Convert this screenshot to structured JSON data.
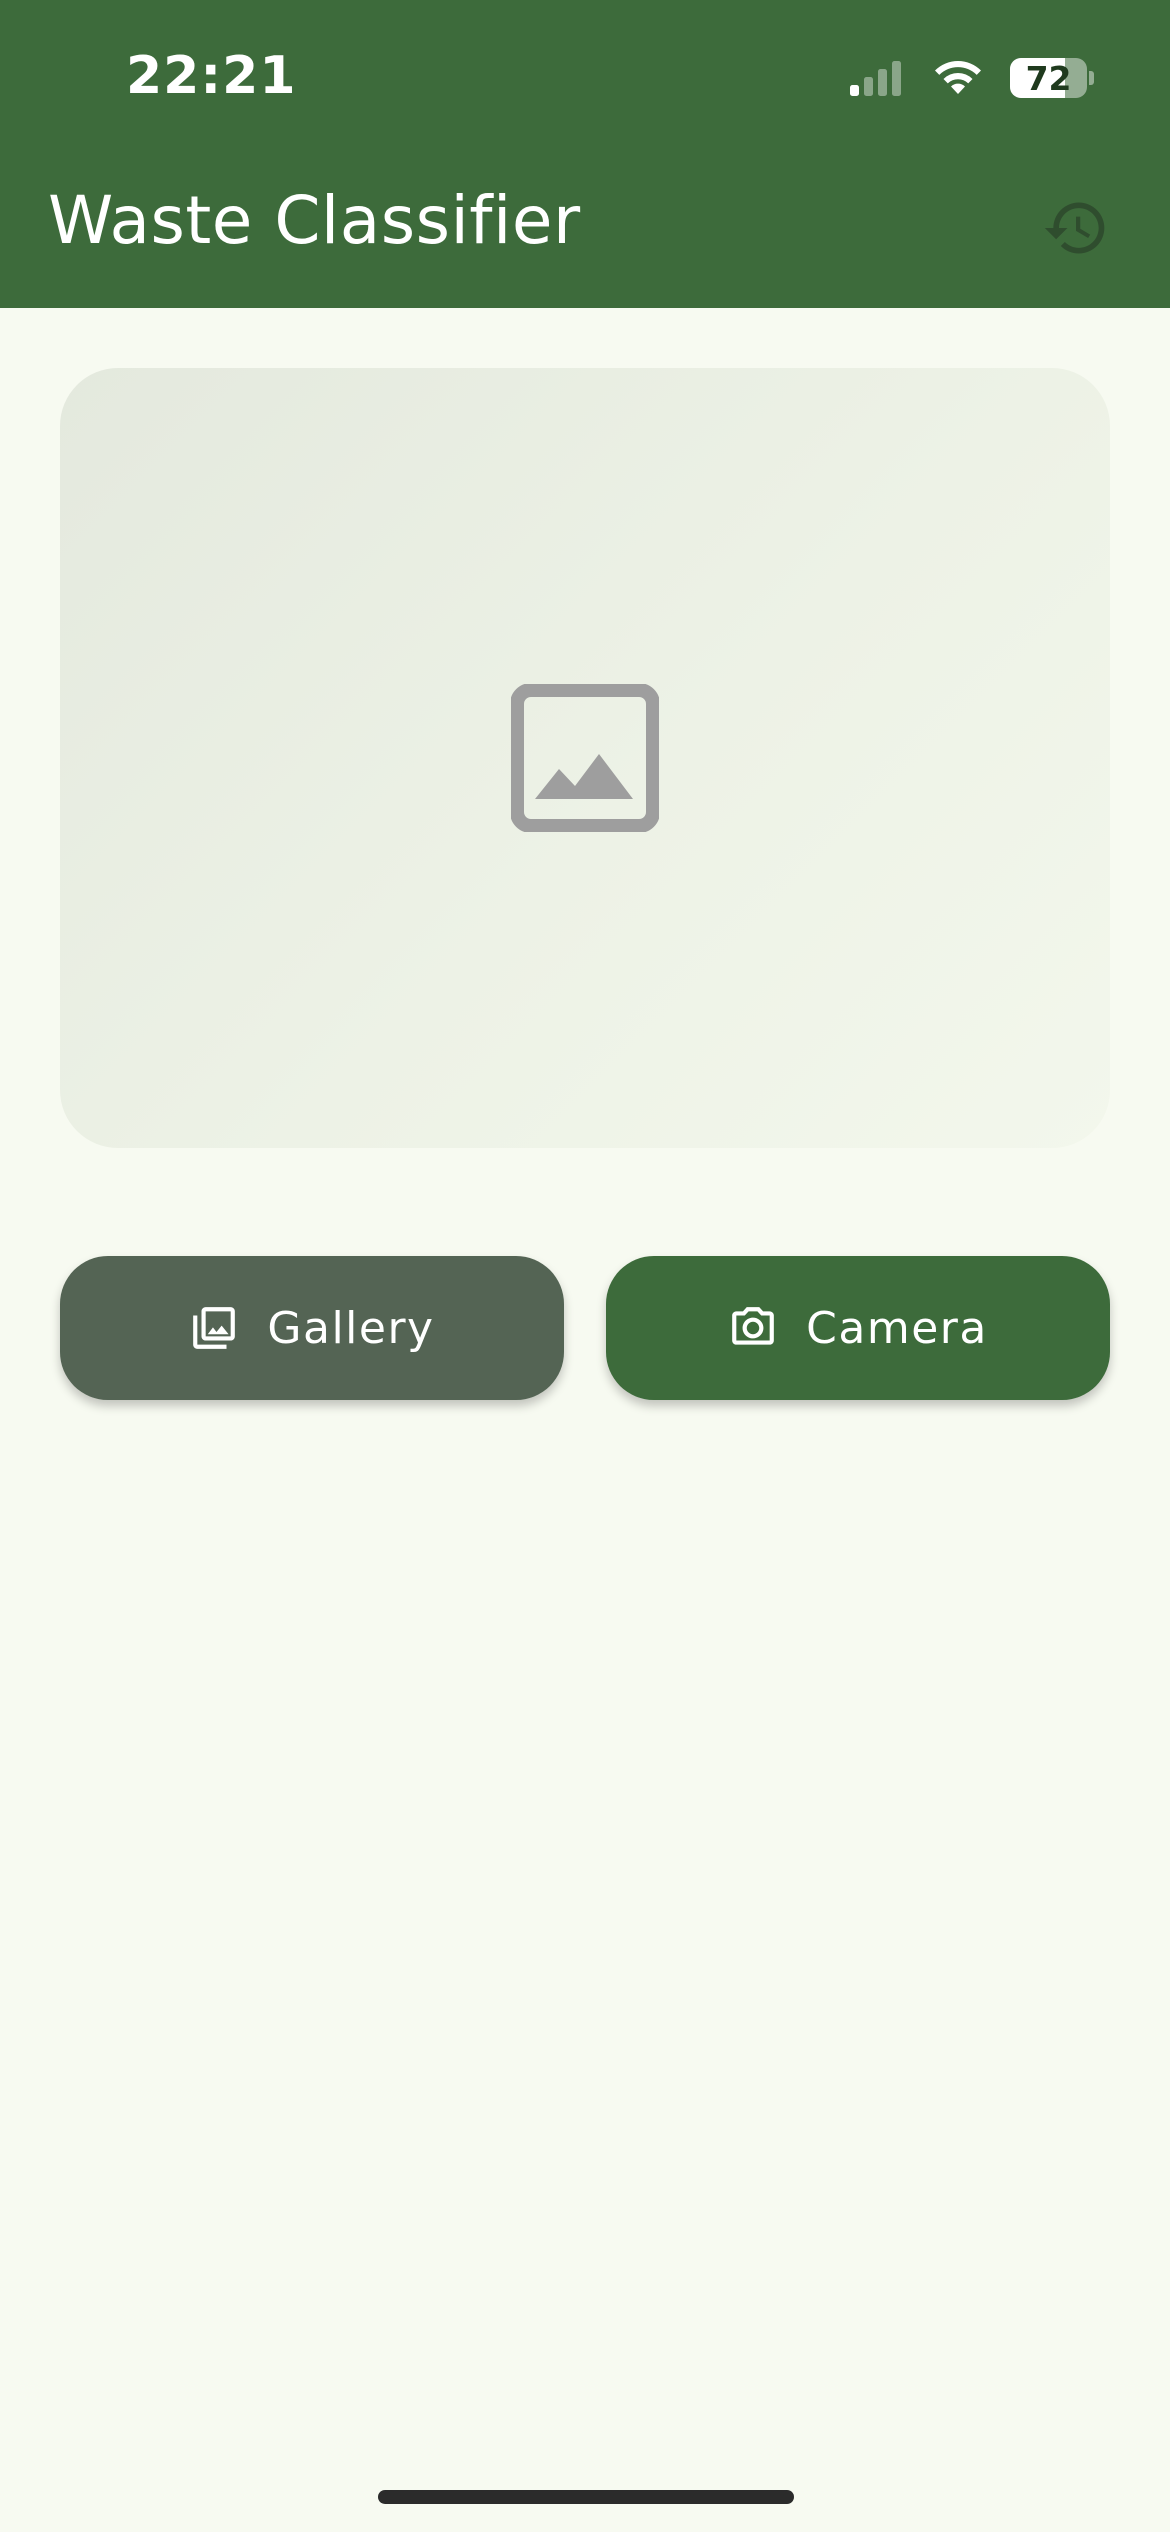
{
  "status_bar": {
    "time": "22:21",
    "battery_level": "72",
    "signal_icon": "cellular-signal-icon",
    "wifi_icon": "wifi-icon",
    "battery_icon": "battery-icon"
  },
  "app_bar": {
    "title": "Waste Classifier",
    "history_icon": "history-icon"
  },
  "preview": {
    "placeholder_icon": "image-placeholder-icon"
  },
  "actions": {
    "gallery_label": "Gallery",
    "gallery_icon": "photo-library-icon",
    "camera_label": "Camera",
    "camera_icon": "camera-icon"
  },
  "colors": {
    "primary": "#3d6b3b",
    "secondary": "#546454",
    "background": "#f7faf1",
    "preview_card": "#e8ede2",
    "placeholder_icon": "#9e9e9e",
    "history_icon": "#2f4d2e"
  }
}
